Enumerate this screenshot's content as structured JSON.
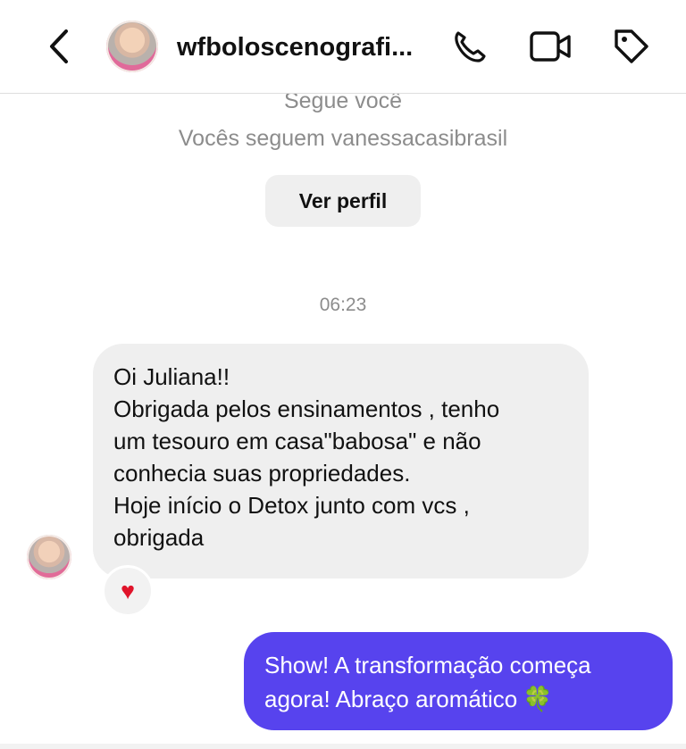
{
  "header": {
    "contact_name": "wfboloscenografi..."
  },
  "profile": {
    "follows_text": "Segue você",
    "mutual_text": "Vocês seguem vanessacasibrasil",
    "view_profile_label": "Ver perfil"
  },
  "conversation": {
    "timestamp": "06:23",
    "incoming_lines": [
      "Oi Juliana!!",
      "Obrigada pelos ensinamentos , tenho",
      "um tesouro em casa\"babosa\" e não",
      "conhecia suas propriedades.",
      "Hoje início o Detox junto com vcs ,",
      "obrigada"
    ],
    "reaction": "♥",
    "outgoing_lines": [
      "Show! A transformação começa",
      "agora! Abraço aromático"
    ],
    "outgoing_emoji": "🍀"
  },
  "colors": {
    "outgoing_bubble": "#5743ee",
    "incoming_bubble": "#efefef",
    "secondary_text": "#8c8c8c",
    "reaction_heart": "#e0132a"
  },
  "icons": [
    "chevron-left-icon",
    "profile-avatar",
    "phone-icon",
    "video-icon",
    "tag-icon",
    "heart-reaction-icon",
    "clover-emoji"
  ]
}
